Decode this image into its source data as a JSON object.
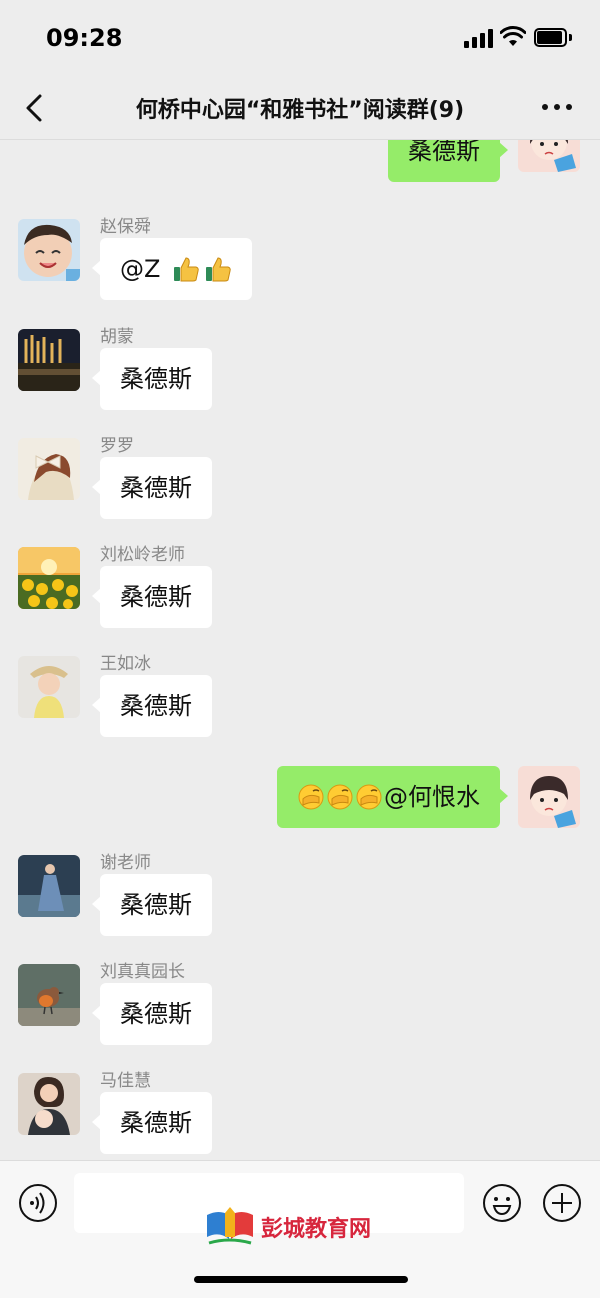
{
  "status_bar": {
    "time": "09:28"
  },
  "nav": {
    "title": "何桥中心园“和雅书社”阅读群(9)"
  },
  "messages": [
    {
      "dir": "out",
      "text": "桑德斯",
      "avatar": "cartoon-girl-avatar"
    },
    {
      "dir": "in",
      "sender": "赵保舜",
      "text": "@Z",
      "emoji_suffix": [
        "thumbs-up",
        "thumbs-up"
      ],
      "avatar": "child-photo-avatar"
    },
    {
      "dir": "in",
      "sender": "胡蒙",
      "text": "桑德斯",
      "avatar": "night-landscape-avatar"
    },
    {
      "dir": "in",
      "sender": "罗罗",
      "text": "桑德斯",
      "avatar": "girl-with-bow-avatar"
    },
    {
      "dir": "in",
      "sender": "刘松岭老师",
      "text": "桑德斯",
      "avatar": "sunflowers-avatar"
    },
    {
      "dir": "in",
      "sender": "王如冰",
      "text": "桑德斯",
      "avatar": "toddler-photo-avatar"
    },
    {
      "dir": "out",
      "text": "@何恨水",
      "emoji_prefix": [
        "facepalm",
        "facepalm",
        "facepalm"
      ],
      "avatar": "cartoon-girl-avatar"
    },
    {
      "dir": "in",
      "sender": "谢老师",
      "text": "桑德斯",
      "avatar": "woman-blue-dress-avatar"
    },
    {
      "dir": "in",
      "sender": "刘真真园长",
      "text": "桑德斯",
      "avatar": "robin-bird-avatar"
    },
    {
      "dir": "in",
      "sender": "马佳慧",
      "text": "桑德斯",
      "avatar": "mother-baby-avatar"
    }
  ],
  "input_bar": {
    "watermark_text": "彭城教育网"
  },
  "colors": {
    "background": "#ededed",
    "outgoing_bubble": "#95ec69",
    "incoming_bubble": "#ffffff",
    "watermark": "#d7263d"
  }
}
